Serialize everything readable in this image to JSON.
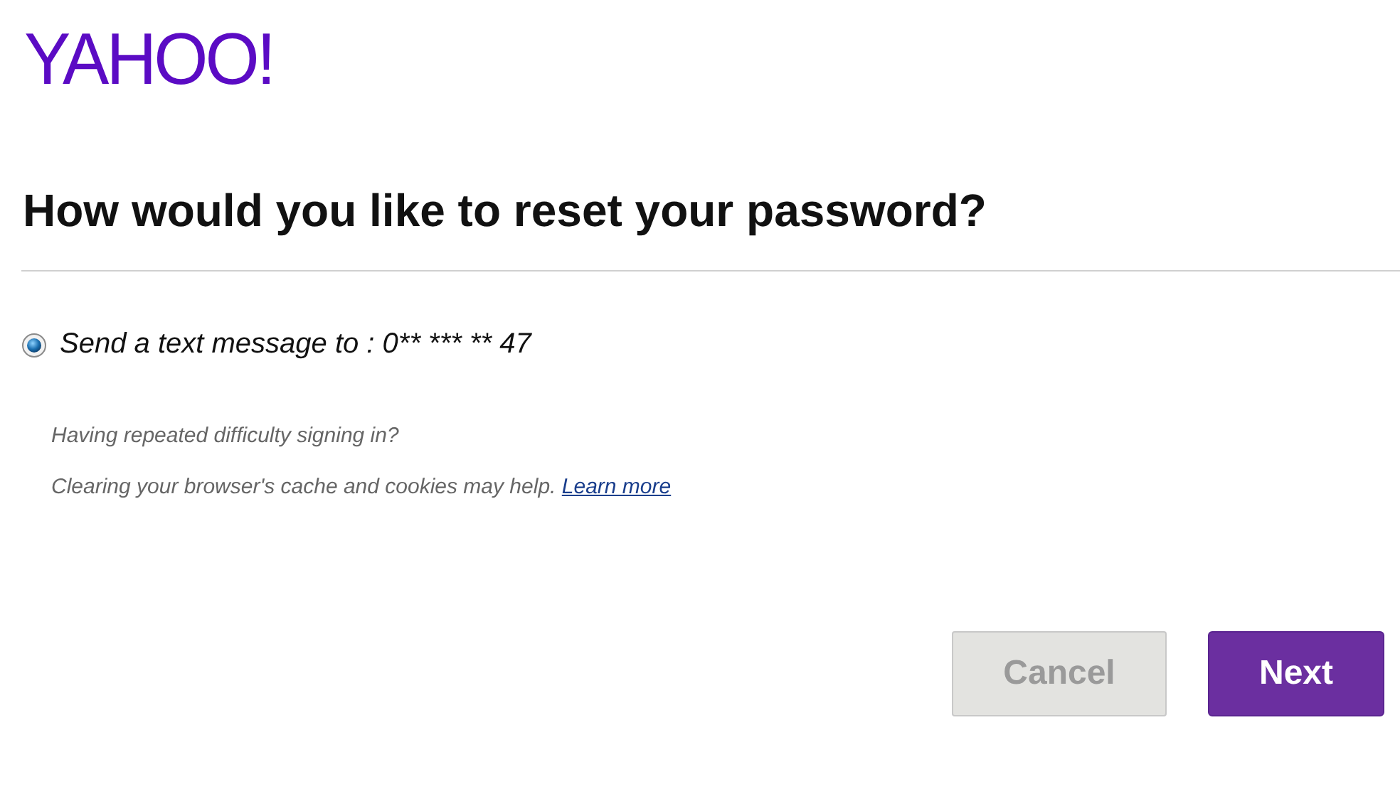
{
  "logo": {
    "text": "YAHOO!"
  },
  "heading": "How would you like to reset your password?",
  "options": [
    {
      "label": "Send a text message to : 0** *** ** 47",
      "selected": true
    }
  ],
  "help": {
    "question": "Having repeated difficulty signing in?",
    "tip": "Clearing your browser's cache and cookies may help.",
    "link": "Learn more"
  },
  "buttons": [
    {
      "label": "Cancel",
      "kind": "secondary"
    },
    {
      "label": "Next",
      "kind": "primary"
    }
  ]
}
